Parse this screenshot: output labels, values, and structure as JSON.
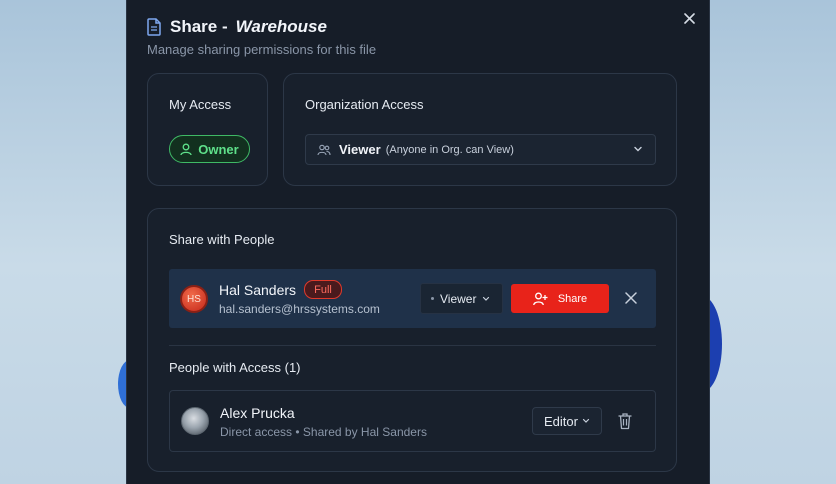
{
  "dialog": {
    "title_prefix": "Share -",
    "title_name": "Warehouse",
    "subtitle": "Manage sharing permissions for this file",
    "close_icon": "close-icon"
  },
  "my_access": {
    "label": "My Access",
    "badge": "Owner",
    "badge_color": "#5ee08a"
  },
  "org_access": {
    "label": "Organization Access",
    "role": "Viewer",
    "description": "(Anyone in Org. can View)"
  },
  "share_with_people": {
    "label": "Share with People",
    "invitee": {
      "initials": "HS",
      "name": "Hal Sanders",
      "badge": "Full",
      "email": "hal.sanders@hrssystems.com",
      "role": "Viewer",
      "share_label": "Share"
    },
    "accent_color": "#e8231a"
  },
  "people_with_access": {
    "label": "People with Access (1)",
    "people": [
      {
        "name": "Alex Prucka",
        "subtitle": "Direct access • Shared by Hal Sanders",
        "role": "Editor"
      }
    ]
  }
}
